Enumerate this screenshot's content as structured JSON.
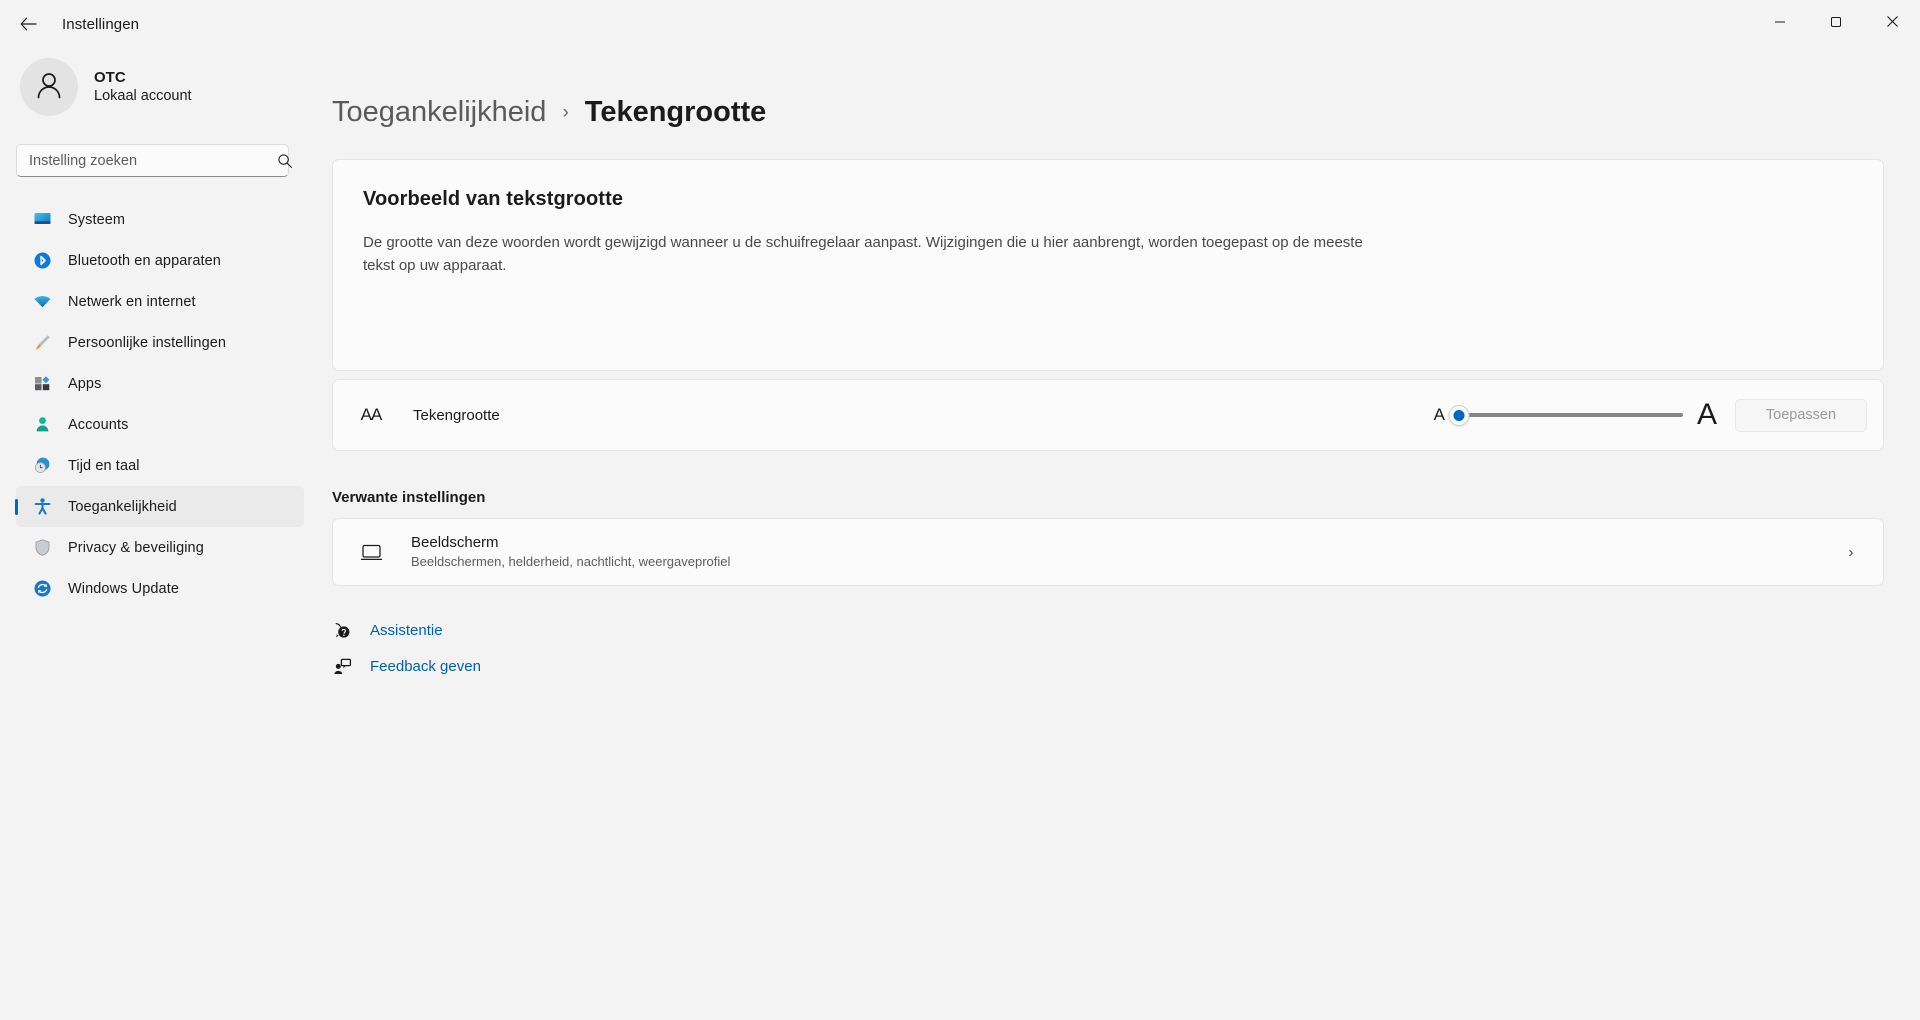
{
  "window": {
    "title": "Instellingen",
    "back_icon": "arrow-left-icon",
    "minimize_label": "—",
    "maximize_label": "❐",
    "close_label": "✕"
  },
  "account": {
    "name": "OTC",
    "subtitle": "Lokaal account",
    "avatar_icon": "person-icon"
  },
  "search": {
    "placeholder": "Instelling zoeken",
    "value": "",
    "icon": "search-icon"
  },
  "sidebar": {
    "items": [
      {
        "label": "Systeem",
        "icon": "monitor-icon",
        "selected": false
      },
      {
        "label": "Bluetooth en apparaten",
        "icon": "bluetooth-icon",
        "selected": false
      },
      {
        "label": "Netwerk en internet",
        "icon": "wifi-icon",
        "selected": false
      },
      {
        "label": "Persoonlijke instellingen",
        "icon": "paintbrush-icon",
        "selected": false
      },
      {
        "label": "Apps",
        "icon": "apps-icon",
        "selected": false
      },
      {
        "label": "Accounts",
        "icon": "account-person-icon",
        "selected": false
      },
      {
        "label": "Tijd en taal",
        "icon": "clock-globe-icon",
        "selected": false
      },
      {
        "label": "Toegankelijkheid",
        "icon": "accessibility-icon",
        "selected": true
      },
      {
        "label": "Privacy & beveiliging",
        "icon": "shield-icon",
        "selected": false
      },
      {
        "label": "Windows Update",
        "icon": "update-refresh-icon",
        "selected": false
      }
    ]
  },
  "breadcrumb": {
    "parent": "Toegankelijkheid",
    "separator": "›",
    "current": "Tekengrootte"
  },
  "preview": {
    "title": "Voorbeeld van tekstgrootte",
    "body": "De grootte van deze woorden wordt gewijzigd wanneer u de schuifregelaar aanpast. Wijzigingen die u hier aanbrengt, worden toegepast op de meeste tekst op uw apparaat."
  },
  "text_size": {
    "icon": "aa-text-size-icon",
    "icon_glyph": "AA",
    "label": "Tekengrootte",
    "slider_min_label": "A",
    "slider_max_label": "A",
    "slider_value": 0,
    "slider_min": 0,
    "slider_max": 100,
    "apply_label": "Toepassen",
    "apply_disabled": true,
    "accent_color": "#0067c0",
    "track_color": "#868686"
  },
  "related": {
    "heading": "Verwante instellingen",
    "items": [
      {
        "title": "Beeldscherm",
        "subtitle": "Beeldschermen, helderheid, nachtlicht, weergaveprofiel",
        "icon": "display-monitor-icon",
        "chevron": "›"
      }
    ]
  },
  "footer": {
    "links": [
      {
        "label": "Assistentie",
        "icon": "help-question-icon"
      },
      {
        "label": "Feedback geven",
        "icon": "feedback-person-icon"
      }
    ],
    "link_color": "#005fb8"
  }
}
